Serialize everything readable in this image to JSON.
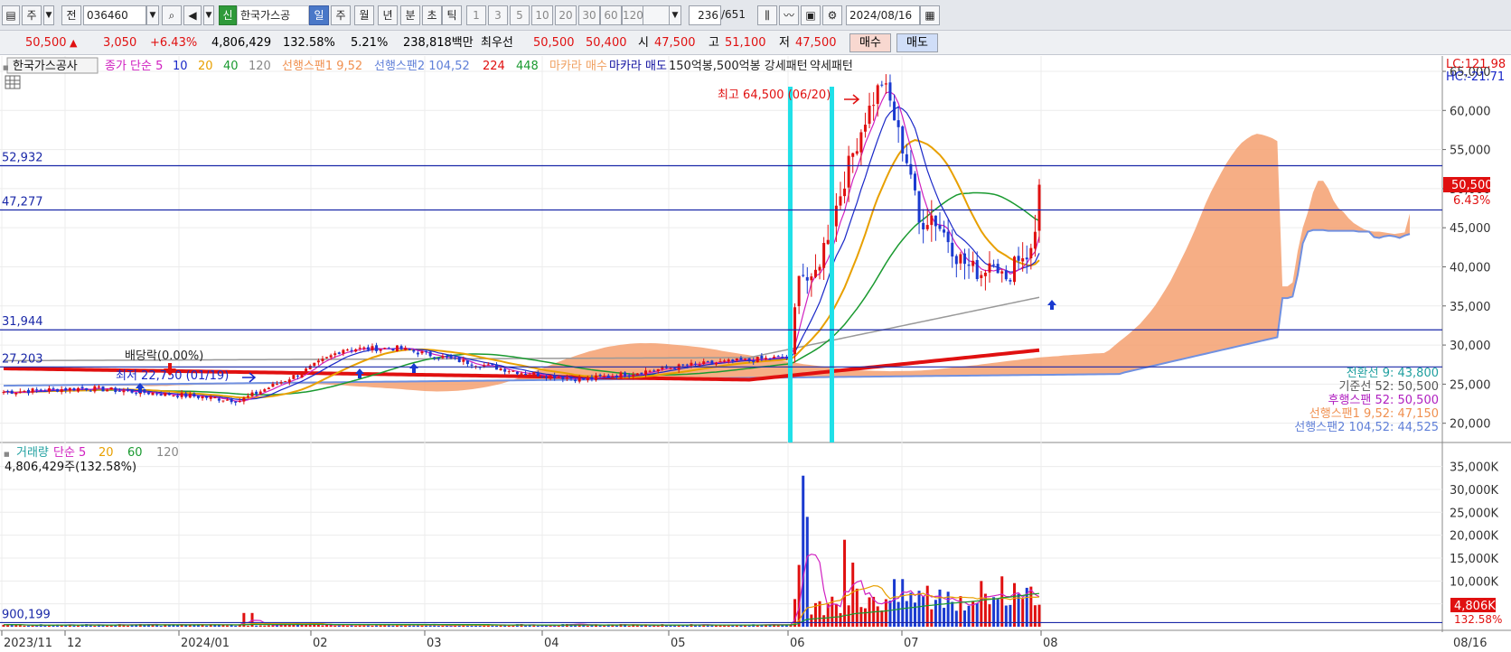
{
  "toolbar": {
    "market_label": "주",
    "prev_label": "전",
    "code": "036460",
    "credit_label": "신",
    "stock_name": "한국가스공",
    "periods": [
      "일",
      "주",
      "월",
      "년",
      "분",
      "초",
      "틱"
    ],
    "active_period": "일",
    "intervals": [
      "1",
      "3",
      "5",
      "10",
      "20",
      "30",
      "60",
      "120"
    ],
    "count": "236",
    "total": "/651",
    "date": "2024/08/16"
  },
  "quote": {
    "price": "50,500",
    "arrow": "▲",
    "change": "3,050",
    "change_pct": "+6.43%",
    "volume": "4,806,429",
    "volume_ratio": "132.58%",
    "turnover": "5.21%",
    "amount": "238,818백만",
    "best_label": "최우선",
    "best_ask": "50,500",
    "best_bid": "50,400",
    "open_label": "시",
    "open": "47,500",
    "high_label": "고",
    "high": "51,100",
    "low_label": "저",
    "low": "47,500",
    "buy_label": "매수",
    "sell_label": "매도"
  },
  "legend": {
    "name": "한국가스공사",
    "items": [
      {
        "text": "종가 단순 5",
        "color": "#d020c0"
      },
      {
        "text": "10",
        "color": "#1a28c8"
      },
      {
        "text": "20",
        "color": "#e8a000"
      },
      {
        "text": "40",
        "color": "#1a9a30"
      },
      {
        "text": "120",
        "color": "#888888"
      },
      {
        "text": "선행스팬1 9,52",
        "color": "#f09050"
      },
      {
        "text": "선행스팬2 104,52",
        "color": "#6080d8"
      },
      {
        "text": "224",
        "color": "#e01010"
      },
      {
        "text": "448",
        "color": "#1a9a30"
      },
      {
        "text": "마카라 매수",
        "color": "#f0a060"
      },
      {
        "text": "마카라 매도",
        "color": "#1010a0"
      },
      {
        "text": "150억봉,500억봉 강세패턴",
        "color": "#222222"
      },
      {
        "text": "약세패턴",
        "color": "#222222"
      }
    ],
    "lc": "LC:121.98",
    "hc": "HC:-21.71"
  },
  "chart_data": {
    "type": "line",
    "price_axis": {
      "ylim": [
        18000,
        66500
      ],
      "ticks": [
        "65,000",
        "60,000",
        "55,000",
        "50,000",
        "45,000",
        "40,000",
        "35,000",
        "30,000",
        "25,000",
        "20,000"
      ],
      "tick_values": [
        65000,
        60000,
        55000,
        50000,
        45000,
        40000,
        35000,
        30000,
        25000,
        20000
      ]
    },
    "hlines": [
      {
        "label": "52,932",
        "value": 52932
      },
      {
        "label": "47,277",
        "value": 47277
      },
      {
        "label": "31,944",
        "value": 31944
      },
      {
        "label": "27,203",
        "value": 27203
      }
    ],
    "annotations": {
      "high": "최고 64,500 (06/20)",
      "low": "최저 22,750 (01/19)",
      "dividend": "배당락(0.00%)"
    },
    "last_price": "50,500",
    "last_pct": "6.43%",
    "ichimoku": [
      {
        "text": "전환선 9: 43,800",
        "color": "#20a0a0"
      },
      {
        "text": "기준선 52: 50,500",
        "color": "#555555"
      },
      {
        "text": "후행스팬 52: 50,500",
        "color": "#b020c0"
      },
      {
        "text": "선행스팬1 9,52: 47,150",
        "color": "#f09050"
      },
      {
        "text": "선행스팬2 104,52: 44,525",
        "color": "#6080d8"
      }
    ],
    "x_labels": [
      "2023/11",
      "12",
      "2024/01",
      "02",
      "03",
      "04",
      "05",
      "06",
      "07",
      "08",
      "08/16"
    ],
    "volume": {
      "legend": [
        {
          "text": "거래량",
          "color": "#20a0a0"
        },
        {
          "text": "단순 5",
          "color": "#d020c0"
        },
        {
          "text": "20",
          "color": "#e8a000"
        },
        {
          "text": "60",
          "color": "#1a9a30"
        },
        {
          "text": "120",
          "color": "#888888"
        }
      ],
      "current": "4,806,429주(132.58%)",
      "ticks": [
        "35,000K",
        "30,000K",
        "25,000K",
        "20,000K",
        "15,000K",
        "10,000K",
        "5,000K"
      ],
      "tick_values": [
        35000,
        30000,
        25000,
        20000,
        15000,
        10000,
        5000
      ],
      "ylim": [
        0,
        36500
      ],
      "ref_label": "900,199",
      "ref_value": 900.199,
      "last": "4,806K",
      "last_pct": "132.58%"
    }
  }
}
